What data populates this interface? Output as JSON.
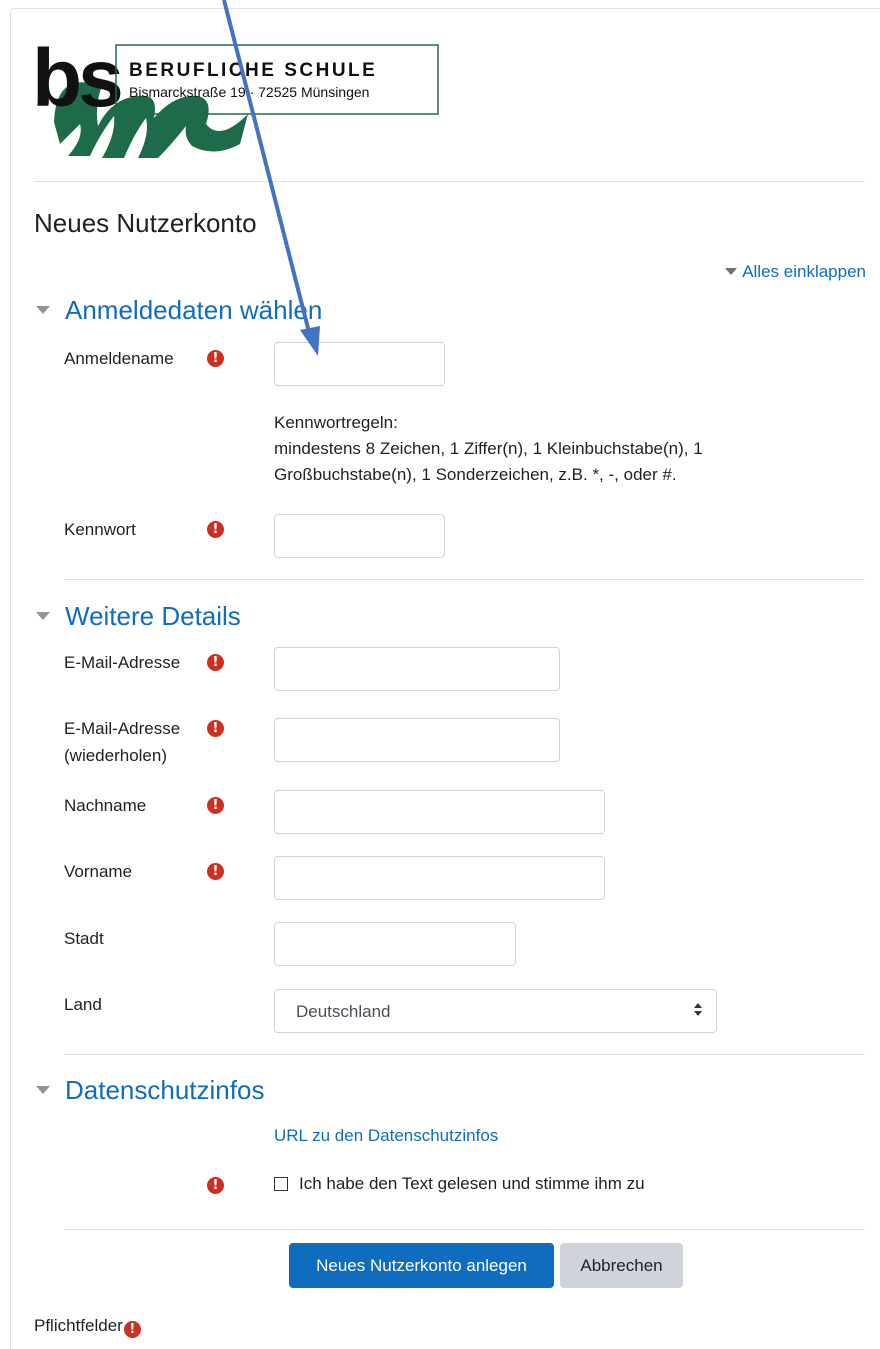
{
  "logo": {
    "initials": "bs",
    "script_letter": "m",
    "school_name": "BERUFLICHE SCHULE",
    "address": "Bismarckstraße 19 · 72525 Münsingen",
    "colors": {
      "dark": "#111111",
      "green": "#1e6b4a"
    }
  },
  "page_title": "Neues Nutzerkonto",
  "collapse_all": "Alles einklappen",
  "required_icon": "!",
  "sections": {
    "login": {
      "title": "Anmeldedaten wählen",
      "username_label": "Anmeldename",
      "password_rules_title": "Kennwortregeln:",
      "password_rules_text": "mindestens 8 Zeichen, 1 Ziffer(n), 1 Kleinbuchstabe(n), 1 Großbuchstabe(n), 1 Sonderzeichen, z.B. *, -, oder #.",
      "password_label": "Kennwort"
    },
    "details": {
      "title": "Weitere Details",
      "email_label": "E-Mail-Adresse",
      "email2_label": "E-Mail-Adresse",
      "email2_sublabel": "(wiederholen)",
      "lastname_label": "Nachname",
      "firstname_label": "Vorname",
      "city_label": "Stadt",
      "country_label": "Land",
      "country_value": "Deutschland"
    },
    "privacy": {
      "title": "Datenschutzinfos",
      "link_text": "URL zu den Datenschutzinfos",
      "agree_label": "Ich habe den Text gelesen und stimme ihm zu"
    }
  },
  "buttons": {
    "submit": "Neues Nutzerkonto anlegen",
    "cancel": "Abbrechen"
  },
  "required_note": "Pflichtfelder",
  "colors": {
    "accent": "#0f6cbf",
    "required": "#ca3120",
    "annotation_arrow": "#4472c4"
  },
  "icons": {
    "required": "exclamation-circle-icon",
    "collapse": "triangle-down-icon",
    "select": "sort-arrows-icon",
    "annotation": "arrow-icon"
  }
}
